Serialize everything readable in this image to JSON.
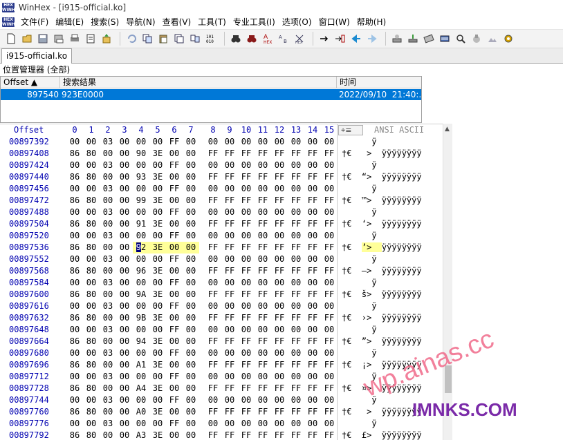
{
  "window": {
    "title": "WinHex - [i915-official.ko]",
    "logo_text": [
      "HEX",
      "WINHEX"
    ]
  },
  "menu": [
    {
      "label": "文件(F)"
    },
    {
      "label": "编辑(E)"
    },
    {
      "label": "搜索(S)"
    },
    {
      "label": "导航(N)"
    },
    {
      "label": "查看(V)"
    },
    {
      "label": "工具(T)"
    },
    {
      "label": "专业工具(I)"
    },
    {
      "label": "选项(O)"
    },
    {
      "label": "窗口(W)"
    },
    {
      "label": "帮助(H)"
    }
  ],
  "toolbar_icons": [
    [
      "new-file-icon",
      "open-file-icon",
      "save-icon",
      "save-as-icon",
      "print-icon",
      "properties-icon",
      "export-icon"
    ],
    [
      "undo-icon",
      "copy-block-icon",
      "paste-icon",
      "paste-special-icon",
      "copy-hex-icon",
      "binary-icon"
    ],
    [
      "find-text-icon",
      "find-hex-icon",
      "replace-text-icon",
      "replace-hex-icon",
      "find-again-icon"
    ],
    [
      "goto-offset-icon",
      "goto-sector-icon",
      "back-icon",
      "forward-icon"
    ],
    [
      "disk-editor-icon",
      "ram-editor-icon",
      "calculator-icon",
      "hex-converter-icon",
      "analyze-icon",
      "compare-icon",
      "clone-icon",
      "settings-icon"
    ]
  ],
  "tab": {
    "label": "i915-official.ko"
  },
  "position_manager": {
    "label": "位置管理器 (全部)",
    "columns": [
      "Offset ▲",
      "搜索结果",
      "时间"
    ],
    "rows": [
      {
        "offset": "897540",
        "result": "923E0000",
        "time": "2022/09/10  21:40:..."
      }
    ]
  },
  "hex_view": {
    "header_offset": "Offset",
    "column_headers": [
      "0",
      "1",
      "2",
      "3",
      "4",
      "5",
      "6",
      "7",
      "8",
      "9",
      "10",
      "11",
      "12",
      "13",
      "14",
      "15"
    ],
    "charset_label": "ANSI ASCII",
    "rows": [
      {
        "offset": "00897392",
        "bytes": [
          "00",
          "00",
          "03",
          "00",
          "00",
          "00",
          "FF",
          "00",
          "00",
          "00",
          "00",
          "00",
          "00",
          "00",
          "00",
          "00"
        ],
        "ascii": "      ÿ         "
      },
      {
        "offset": "00897408",
        "bytes": [
          "86",
          "80",
          "00",
          "00",
          "90",
          "3E",
          "00",
          "00",
          "FF",
          "FF",
          "FF",
          "FF",
          "FF",
          "FF",
          "FF",
          "FF"
        ],
        "ascii": "†€   >  ÿÿÿÿÿÿÿÿ"
      },
      {
        "offset": "00897424",
        "bytes": [
          "00",
          "00",
          "03",
          "00",
          "00",
          "00",
          "FF",
          "00",
          "00",
          "00",
          "00",
          "00",
          "00",
          "00",
          "00",
          "00"
        ],
        "ascii": "      ÿ         "
      },
      {
        "offset": "00897440",
        "bytes": [
          "86",
          "80",
          "00",
          "00",
          "93",
          "3E",
          "00",
          "00",
          "FF",
          "FF",
          "FF",
          "FF",
          "FF",
          "FF",
          "FF",
          "FF"
        ],
        "ascii": "†€  “>  ÿÿÿÿÿÿÿÿ"
      },
      {
        "offset": "00897456",
        "bytes": [
          "00",
          "00",
          "03",
          "00",
          "00",
          "00",
          "FF",
          "00",
          "00",
          "00",
          "00",
          "00",
          "00",
          "00",
          "00",
          "00"
        ],
        "ascii": "      ÿ         "
      },
      {
        "offset": "00897472",
        "bytes": [
          "86",
          "80",
          "00",
          "00",
          "99",
          "3E",
          "00",
          "00",
          "FF",
          "FF",
          "FF",
          "FF",
          "FF",
          "FF",
          "FF",
          "FF"
        ],
        "ascii": "†€  ™>  ÿÿÿÿÿÿÿÿ"
      },
      {
        "offset": "00897488",
        "bytes": [
          "00",
          "00",
          "03",
          "00",
          "00",
          "00",
          "FF",
          "00",
          "00",
          "00",
          "00",
          "00",
          "00",
          "00",
          "00",
          "00"
        ],
        "ascii": "      ÿ         "
      },
      {
        "offset": "00897504",
        "bytes": [
          "86",
          "80",
          "00",
          "00",
          "91",
          "3E",
          "00",
          "00",
          "FF",
          "FF",
          "FF",
          "FF",
          "FF",
          "FF",
          "FF",
          "FF"
        ],
        "ascii": "†€  ‘>  ÿÿÿÿÿÿÿÿ"
      },
      {
        "offset": "00897520",
        "bytes": [
          "00",
          "00",
          "03",
          "00",
          "00",
          "00",
          "FF",
          "00",
          "00",
          "00",
          "00",
          "00",
          "00",
          "00",
          "00",
          "00"
        ],
        "ascii": "      ÿ         "
      },
      {
        "offset": "00897536",
        "bytes": [
          "86",
          "80",
          "00",
          "00",
          "92",
          "3E",
          "00",
          "00",
          "FF",
          "FF",
          "FF",
          "FF",
          "FF",
          "FF",
          "FF",
          "FF"
        ],
        "ascii": "†€  ’>  ÿÿÿÿÿÿÿÿ",
        "highlight": [
          4,
          5,
          6,
          7
        ],
        "cursor": 4
      },
      {
        "offset": "00897552",
        "bytes": [
          "00",
          "00",
          "03",
          "00",
          "00",
          "00",
          "FF",
          "00",
          "00",
          "00",
          "00",
          "00",
          "00",
          "00",
          "00",
          "00"
        ],
        "ascii": "      ÿ         "
      },
      {
        "offset": "00897568",
        "bytes": [
          "86",
          "80",
          "00",
          "00",
          "96",
          "3E",
          "00",
          "00",
          "FF",
          "FF",
          "FF",
          "FF",
          "FF",
          "FF",
          "FF",
          "FF"
        ],
        "ascii": "†€  –>  ÿÿÿÿÿÿÿÿ"
      },
      {
        "offset": "00897584",
        "bytes": [
          "00",
          "00",
          "03",
          "00",
          "00",
          "00",
          "FF",
          "00",
          "00",
          "00",
          "00",
          "00",
          "00",
          "00",
          "00",
          "00"
        ],
        "ascii": "      ÿ         "
      },
      {
        "offset": "00897600",
        "bytes": [
          "86",
          "80",
          "00",
          "00",
          "9A",
          "3E",
          "00",
          "00",
          "FF",
          "FF",
          "FF",
          "FF",
          "FF",
          "FF",
          "FF",
          "FF"
        ],
        "ascii": "†€  š>  ÿÿÿÿÿÿÿÿ"
      },
      {
        "offset": "00897616",
        "bytes": [
          "00",
          "00",
          "03",
          "00",
          "00",
          "00",
          "FF",
          "00",
          "00",
          "00",
          "00",
          "00",
          "00",
          "00",
          "00",
          "00"
        ],
        "ascii": "      ÿ         "
      },
      {
        "offset": "00897632",
        "bytes": [
          "86",
          "80",
          "00",
          "00",
          "9B",
          "3E",
          "00",
          "00",
          "FF",
          "FF",
          "FF",
          "FF",
          "FF",
          "FF",
          "FF",
          "FF"
        ],
        "ascii": "†€  ›>  ÿÿÿÿÿÿÿÿ"
      },
      {
        "offset": "00897648",
        "bytes": [
          "00",
          "00",
          "03",
          "00",
          "00",
          "00",
          "FF",
          "00",
          "00",
          "00",
          "00",
          "00",
          "00",
          "00",
          "00",
          "00"
        ],
        "ascii": "      ÿ         "
      },
      {
        "offset": "00897664",
        "bytes": [
          "86",
          "80",
          "00",
          "00",
          "94",
          "3E",
          "00",
          "00",
          "FF",
          "FF",
          "FF",
          "FF",
          "FF",
          "FF",
          "FF",
          "FF"
        ],
        "ascii": "†€  ”>  ÿÿÿÿÿÿÿÿ"
      },
      {
        "offset": "00897680",
        "bytes": [
          "00",
          "00",
          "03",
          "00",
          "00",
          "00",
          "FF",
          "00",
          "00",
          "00",
          "00",
          "00",
          "00",
          "00",
          "00",
          "00"
        ],
        "ascii": "      ÿ         "
      },
      {
        "offset": "00897696",
        "bytes": [
          "86",
          "80",
          "00",
          "00",
          "A1",
          "3E",
          "00",
          "00",
          "FF",
          "FF",
          "FF",
          "FF",
          "FF",
          "FF",
          "FF",
          "FF"
        ],
        "ascii": "†€  ¡>  ÿÿÿÿÿÿÿÿ"
      },
      {
        "offset": "00897712",
        "bytes": [
          "00",
          "00",
          "03",
          "00",
          "00",
          "00",
          "FF",
          "00",
          "00",
          "00",
          "00",
          "00",
          "00",
          "00",
          "00",
          "00"
        ],
        "ascii": "      ÿ         "
      },
      {
        "offset": "00897728",
        "bytes": [
          "86",
          "80",
          "00",
          "00",
          "A4",
          "3E",
          "00",
          "00",
          "FF",
          "FF",
          "FF",
          "FF",
          "FF",
          "FF",
          "FF",
          "FF"
        ],
        "ascii": "†€  ¤>  ÿÿÿÿÿÿÿÿ"
      },
      {
        "offset": "00897744",
        "bytes": [
          "00",
          "00",
          "03",
          "00",
          "00",
          "00",
          "FF",
          "00",
          "00",
          "00",
          "00",
          "00",
          "00",
          "00",
          "00",
          "00"
        ],
        "ascii": "      ÿ         "
      },
      {
        "offset": "00897760",
        "bytes": [
          "86",
          "80",
          "00",
          "00",
          "A0",
          "3E",
          "00",
          "00",
          "FF",
          "FF",
          "FF",
          "FF",
          "FF",
          "FF",
          "FF",
          "FF"
        ],
        "ascii": "†€   >  ÿÿÿÿÿÿÿÿ"
      },
      {
        "offset": "00897776",
        "bytes": [
          "00",
          "00",
          "03",
          "00",
          "00",
          "00",
          "FF",
          "00",
          "00",
          "00",
          "00",
          "00",
          "00",
          "00",
          "00",
          "00"
        ],
        "ascii": "      ÿ         "
      },
      {
        "offset": "00897792",
        "bytes": [
          "86",
          "80",
          "00",
          "00",
          "A3",
          "3E",
          "00",
          "00",
          "FF",
          "FF",
          "FF",
          "FF",
          "FF",
          "FF",
          "FF",
          "FF"
        ],
        "ascii": "†€  £>  ÿÿÿÿÿÿÿÿ"
      }
    ]
  },
  "watermark": {
    "line1": "wp.ainas.cc",
    "line2": "IMNKS.COM"
  },
  "colors": {
    "selection": "#0078d7",
    "offset_blue": "#0000b0",
    "highlight": "#ffff99",
    "cursor": "#000080"
  }
}
